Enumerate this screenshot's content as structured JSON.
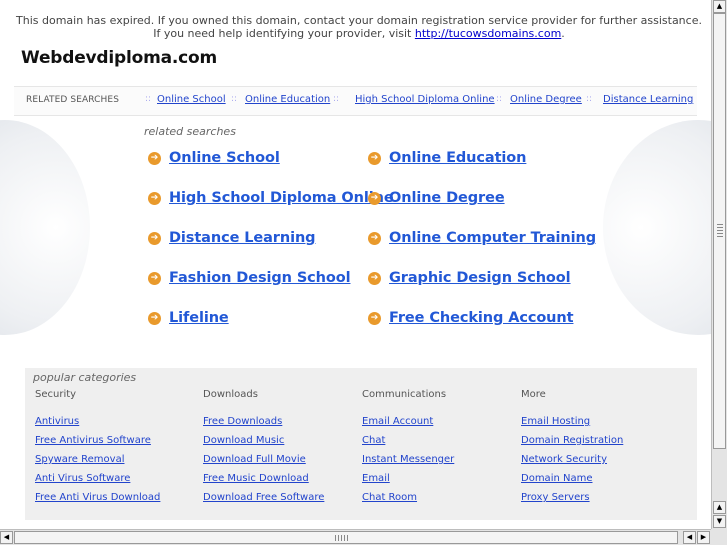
{
  "notice": {
    "text": "This domain has expired. If you owned this domain, contact your domain registration service provider for further assistance. If you need help identifying your provider, visit ",
    "link": "http://tucowsdomains.com",
    "suffix": "."
  },
  "site_title": "Webdevdiploma.com",
  "related_bar": {
    "label": "RELATED SEARCHES",
    "separator": "::",
    "links": [
      "Online School",
      "Online Education",
      "High School Diploma Online",
      "Online Degree",
      "Distance Learning"
    ]
  },
  "related": {
    "label": "related searches",
    "items": [
      "Online School",
      "Online Education",
      "High School Diploma Online",
      "Online Degree",
      "Distance Learning",
      "Online Computer Training",
      "Fashion Design School",
      "Graphic Design School",
      "Lifeline",
      "Free Checking Account"
    ]
  },
  "popular": {
    "label": "popular categories",
    "columns": [
      {
        "header": "Security",
        "items": [
          "Antivirus",
          "Free Antivirus Software",
          "Spyware Removal",
          "Anti Virus Software",
          "Free Anti Virus Download"
        ]
      },
      {
        "header": "Downloads",
        "items": [
          "Free Downloads",
          "Download Music",
          "Download Full Movie",
          "Free Music Download",
          "Download Free Software"
        ]
      },
      {
        "header": "Communications",
        "items": [
          "Email Account",
          "Chat",
          "Instant Messenger",
          "Email",
          "Chat Room"
        ]
      },
      {
        "header": "More",
        "items": [
          "Email Hosting",
          "Domain Registration",
          "Network Security",
          "Domain Name",
          "Proxy Servers"
        ]
      }
    ]
  },
  "icons": {
    "arrow": "arrow-circle-icon",
    "scroll_up": "▲",
    "scroll_down": "▼",
    "scroll_left": "◀",
    "scroll_right": "▶"
  },
  "colors": {
    "link": "#2258d6",
    "arrow": "#e99a2c",
    "panel": "#efefef"
  }
}
